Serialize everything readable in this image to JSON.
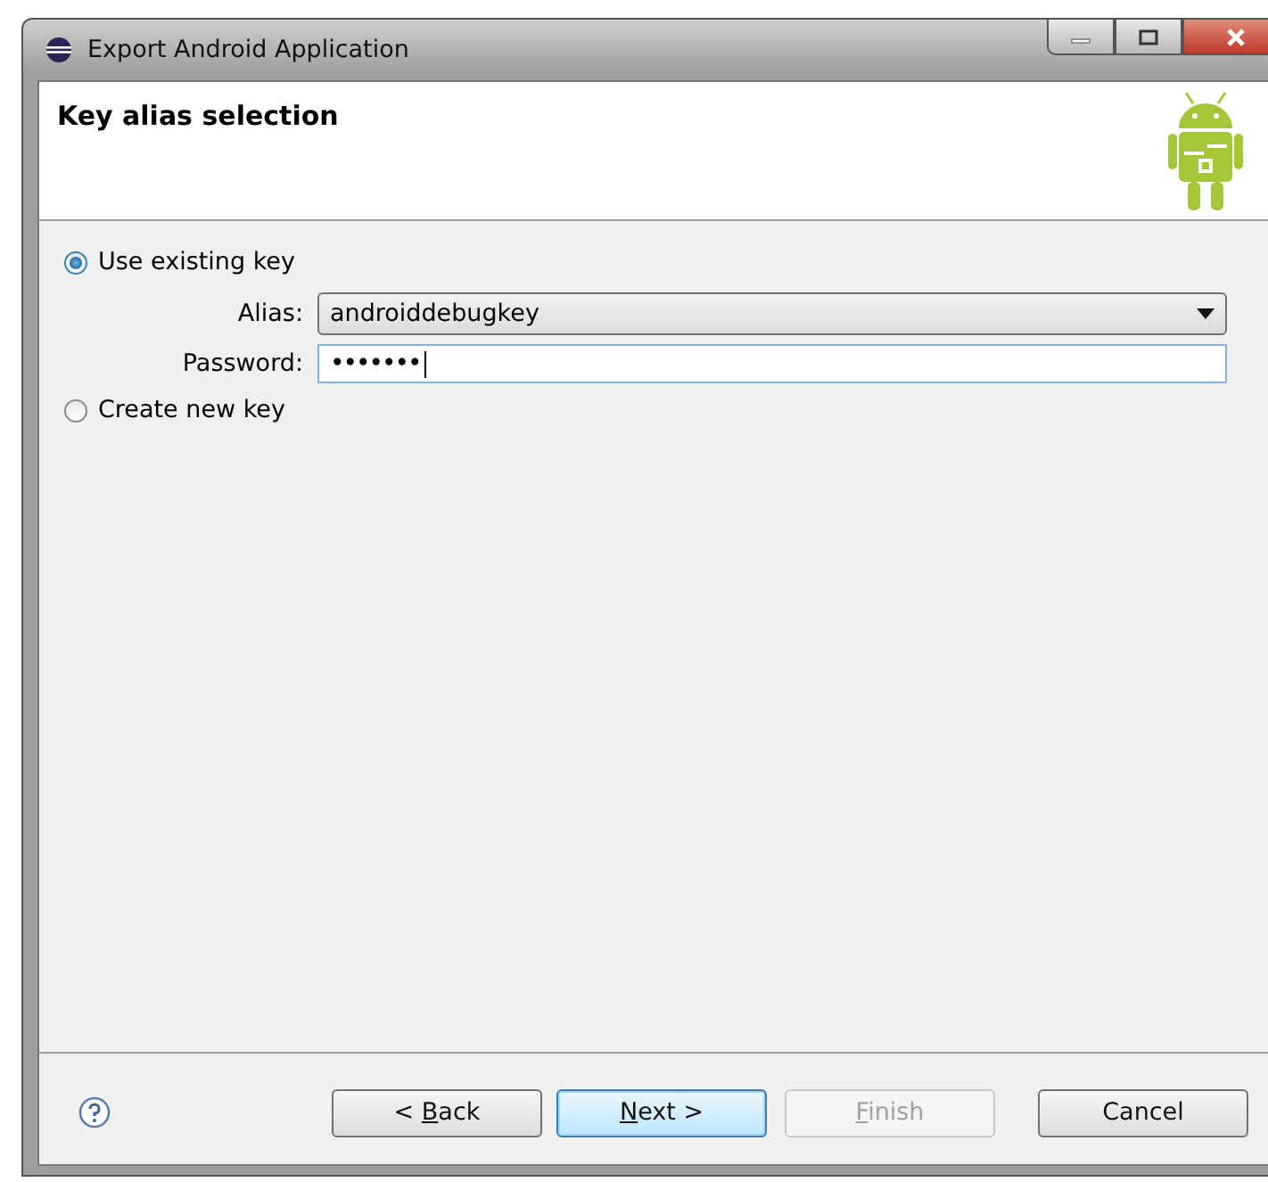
{
  "window": {
    "title": "Export Android Application"
  },
  "header": {
    "title": "Key alias selection"
  },
  "options": [
    {
      "label": "Use existing key",
      "selected": true
    },
    {
      "label": "Create new key",
      "selected": false
    }
  ],
  "alias": {
    "label": "Alias:",
    "value": "androiddebugkey"
  },
  "password": {
    "label": "Password:",
    "value": "•••••••"
  },
  "buttons": [
    {
      "before": "< ",
      "key": "B",
      "after": "ack",
      "disabled": false,
      "default": false
    },
    {
      "key": "N",
      "after": "ext >",
      "disabled": false,
      "default": true
    },
    {
      "key": "F",
      "after": "inish",
      "disabled": true,
      "default": false
    },
    {
      "before": "Cancel",
      "disabled": false,
      "default": false
    }
  ]
}
